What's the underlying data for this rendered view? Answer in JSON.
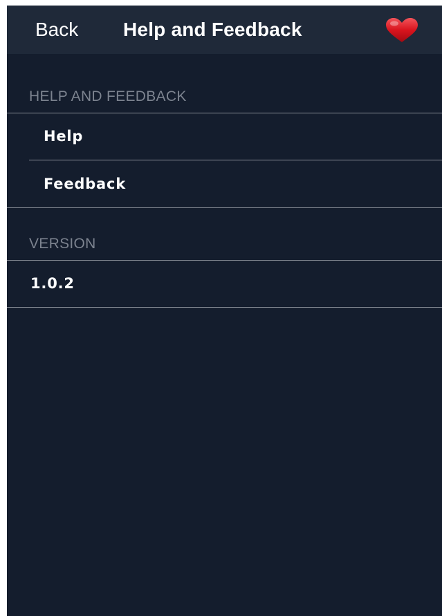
{
  "navbar": {
    "back_label": "Back",
    "title": "Help and Feedback",
    "heart_icon": "heart-icon",
    "heart_color": "#d9141e"
  },
  "sections": {
    "help_feedback": {
      "header": "HELP AND FEEDBACK",
      "items": [
        {
          "label": "Help"
        },
        {
          "label": "Feedback"
        }
      ]
    },
    "version": {
      "header": "VERSION",
      "value": "1.0.2"
    }
  },
  "colors": {
    "background": "#141d2d",
    "navbar": "#1f2939",
    "separator": "#8a8f98",
    "header_text": "#7c838f"
  }
}
